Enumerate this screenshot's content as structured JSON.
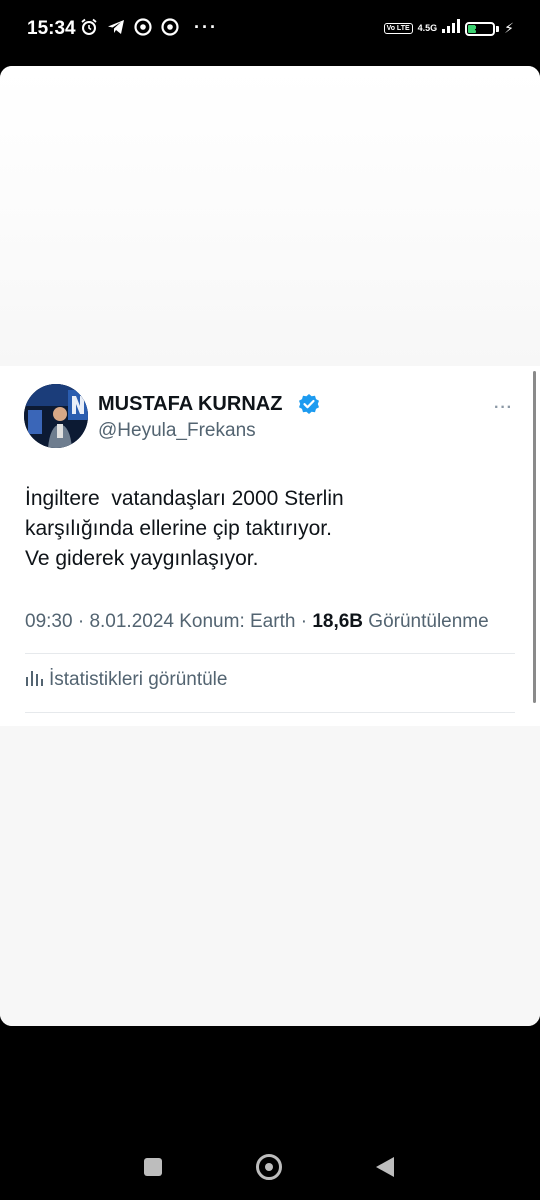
{
  "status_bar": {
    "time": "15:34",
    "left_icons": [
      "alarm-icon",
      "telegram-icon",
      "chrome-icon",
      "chrome-icon"
    ],
    "overflow": "···",
    "volte": "Vo LTE",
    "network": "4.5G",
    "battery": "30",
    "battery_level": 0.3
  },
  "tweet": {
    "display_name": "MUSTAFA KURNAZ",
    "handle": "@Heyula_Frekans",
    "more": "···",
    "text": "İngiltere  vatandaşları 2000 Sterlin\nkarşılığında ellerine çip taktırıyor.\nVe giderek yaygınlaşıyor.",
    "time": "09:30",
    "date": "8.01.2024",
    "location": "Konum: Earth",
    "views_count": "18,6B",
    "views_label": "Görüntülenme",
    "stats_link": "İstatistikleri görüntüle"
  },
  "colors": {
    "verified": "#1d9bf0",
    "text": "#0f1419",
    "secondary": "#536471"
  }
}
